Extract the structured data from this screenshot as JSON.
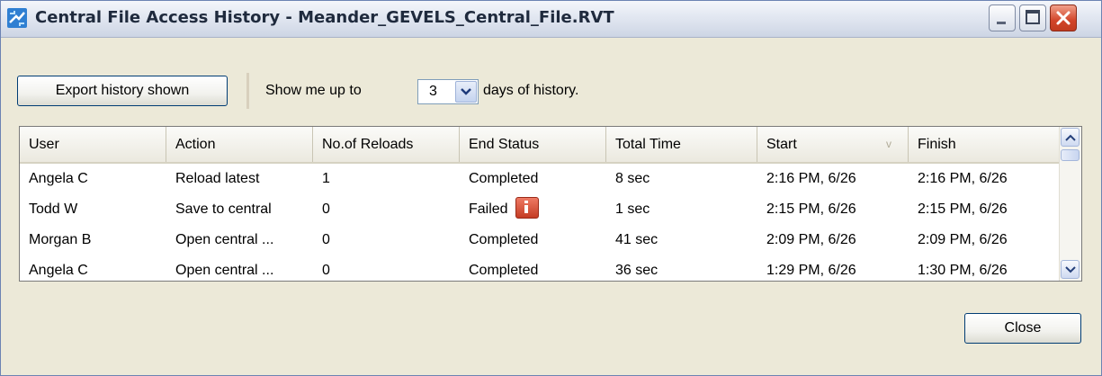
{
  "window": {
    "title": "Central File Access History - Meander_GEVELS_Central_File.RVT"
  },
  "toolbar": {
    "export_label": "Export history shown",
    "show_me_label": "Show me up to",
    "days_value": "3",
    "days_suffix": "days of  history."
  },
  "table": {
    "columns": [
      "User",
      "Action",
      "No.of Reloads",
      "End Status",
      "Total Time",
      "Start",
      "Finish"
    ],
    "sort_indicator": "v",
    "rows": [
      {
        "user": "Angela C",
        "action": "Reload latest",
        "reloads": "1",
        "status": "Completed",
        "time": "8 sec",
        "start": "2:16 PM, 6/26",
        "finish": "2:16 PM, 6/26"
      },
      {
        "user": "Todd W",
        "action": "Save to central",
        "reloads": "0",
        "status": "Failed",
        "time": "1 sec",
        "start": "2:15 PM, 6/26",
        "finish": "2:15 PM, 6/26"
      },
      {
        "user": "Morgan B",
        "action": "Open central ...",
        "reloads": "0",
        "status": "Completed",
        "time": "41 sec",
        "start": "2:09 PM, 6/26",
        "finish": "2:09 PM, 6/26"
      },
      {
        "user": "Angela C",
        "action": "Open central ...",
        "reloads": "0",
        "status": "Completed",
        "time": "36 sec",
        "start": "1:29 PM, 6/26",
        "finish": "1:30 PM, 6/26"
      }
    ]
  },
  "footer": {
    "close_label": "Close"
  },
  "icons": {
    "app": "revit-app-icon",
    "minimize": "minimize-icon",
    "maximize": "maximize-icon",
    "close": "close-icon",
    "failed_info": "info-icon"
  },
  "colors": {
    "close_button": "#d2452a",
    "failed_icon": "#c43c24",
    "window_bg": "#ece9d8"
  }
}
